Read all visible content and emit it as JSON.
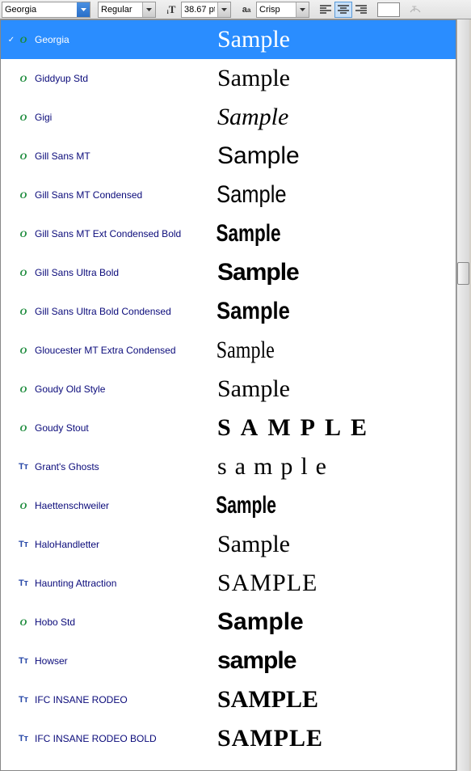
{
  "toolbar": {
    "font_family": "Georgia",
    "font_style": "Regular",
    "font_size": "38.67 pt",
    "aa_mode": "Crisp"
  },
  "sample_text": "Sample",
  "fonts": [
    {
      "name": "Georgia",
      "type": "o",
      "selected": true,
      "style": "s-georgia"
    },
    {
      "name": "Giddyup Std",
      "type": "o",
      "style": "s-script"
    },
    {
      "name": "Gigi",
      "type": "o",
      "style": "s-gigi"
    },
    {
      "name": "Gill Sans MT",
      "type": "o",
      "style": "s-gill"
    },
    {
      "name": "Gill Sans MT Condensed",
      "type": "o",
      "style": "s-gillcond"
    },
    {
      "name": "Gill Sans MT Ext Condensed Bold",
      "type": "o",
      "style": "s-gillext"
    },
    {
      "name": "Gill Sans Ultra Bold",
      "type": "o",
      "style": "s-gillultra"
    },
    {
      "name": "Gill Sans Ultra Bold Condensed",
      "type": "o",
      "style": "s-gillultracond"
    },
    {
      "name": "Gloucester MT Extra Condensed",
      "type": "o",
      "style": "s-gloucester"
    },
    {
      "name": "Goudy Old Style",
      "type": "o",
      "style": "s-goudy"
    },
    {
      "name": "Goudy Stout",
      "type": "o",
      "style": "s-goudystout",
      "upper": true
    },
    {
      "name": "Grant's Ghosts",
      "type": "tt",
      "style": "s-grants",
      "lower": true
    },
    {
      "name": "Haettenschweiler",
      "type": "o",
      "style": "s-haet"
    },
    {
      "name": "HaloHandletter",
      "type": "tt",
      "style": "s-halo"
    },
    {
      "name": "Haunting Attraction",
      "type": "tt",
      "style": "s-haunt",
      "upper": true
    },
    {
      "name": "Hobo Std",
      "type": "o",
      "style": "s-hobo"
    },
    {
      "name": "Howser",
      "type": "tt",
      "style": "s-howser",
      "lower": true
    },
    {
      "name": "IFC INSANE RODEO",
      "type": "tt",
      "style": "s-insane",
      "sc": true
    },
    {
      "name": "IFC INSANE RODEO BOLD",
      "type": "tt",
      "style": "s-insanebold",
      "upper": true
    }
  ]
}
